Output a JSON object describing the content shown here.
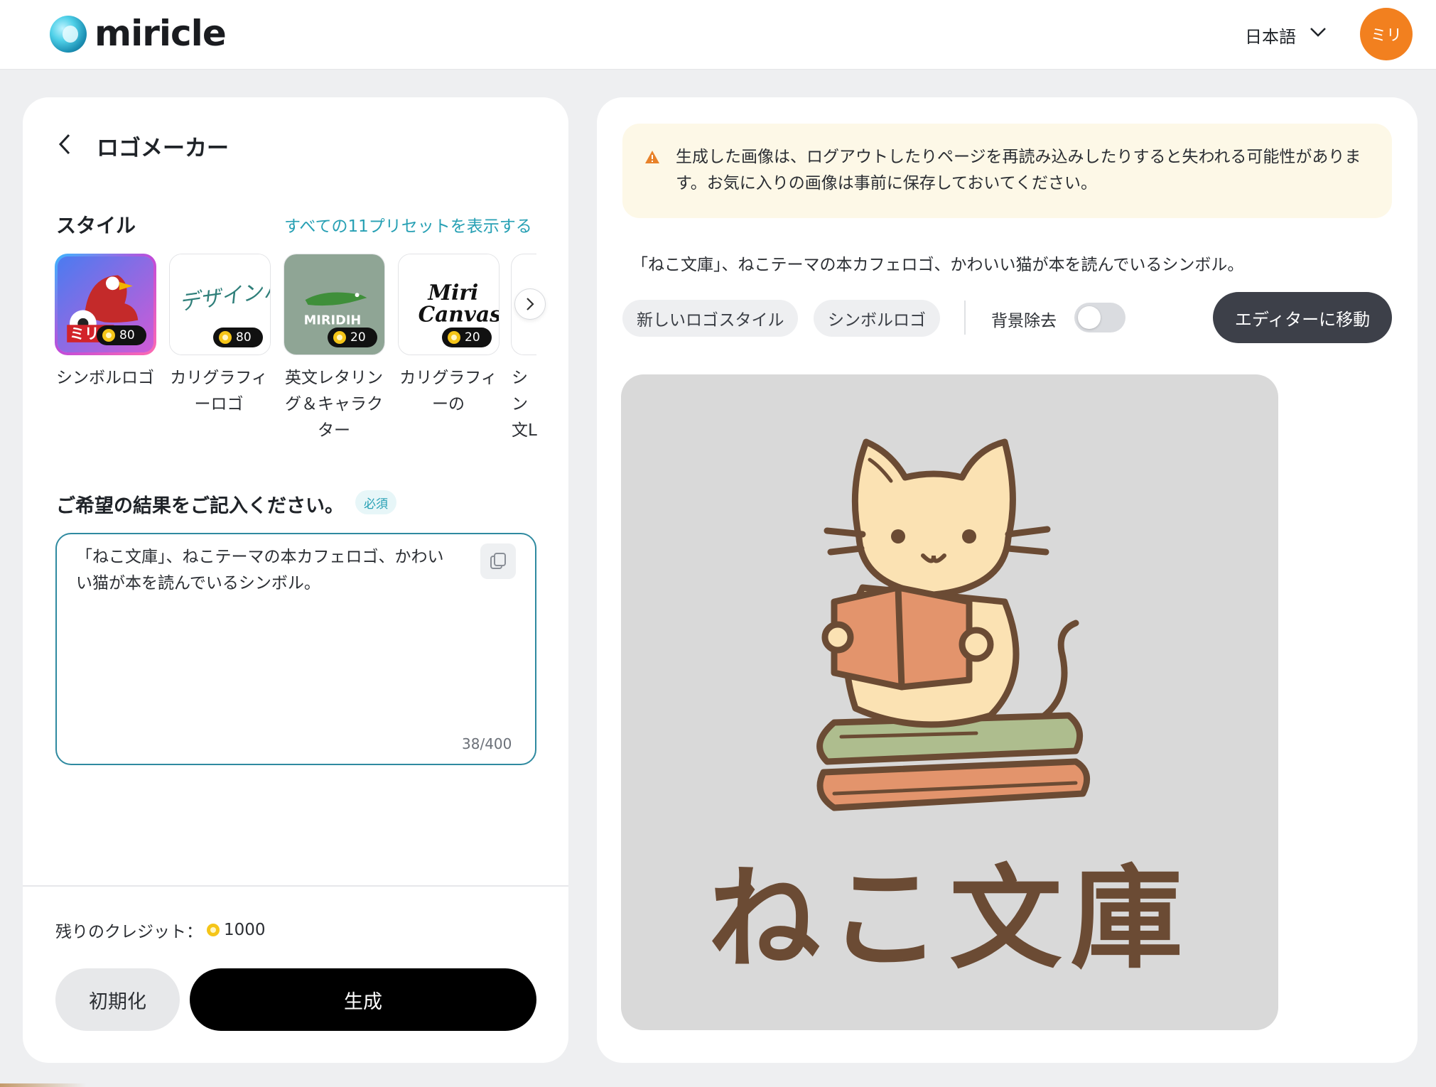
{
  "header": {
    "brand": "miricle",
    "language": "日本語",
    "avatar_initials": "ミリ"
  },
  "left_panel": {
    "title": "ロゴメーカー",
    "style_label": "スタイル",
    "presets_link": "すべての11プリセットを表示する",
    "presets": [
      {
        "label": "シンボルロゴ",
        "credits": "80",
        "selected": true
      },
      {
        "label": "カリグラフィーロゴ",
        "credits": "80",
        "selected": false
      },
      {
        "label": "英文レタリング＆キャラクター",
        "credits": "20",
        "selected": false
      },
      {
        "label": "カリグラフィーの",
        "credits": "20",
        "selected": false
      },
      {
        "label": "シン文L",
        "selected": false
      }
    ],
    "preset_art_text": {
      "p1": "ミリエ",
      "p2": "デザインハブ",
      "p3": "MIRIDIH",
      "p4_line1": "Miri",
      "p4_line2": "Canvas"
    },
    "prompt_label": "ご希望の結果をご記入ください。",
    "required_badge": "必須",
    "prompt_value": "「ねこ文庫」、ねこテーマの本カフェロゴ、かわいい猫が本を読んでいるシンボル。",
    "char_count": "38/400",
    "credits_label": "残りのクレジット：",
    "credits_value": "1000",
    "reset_button": "初期化",
    "generate_button": "生成"
  },
  "right_panel": {
    "notice": "生成した画像は、ログアウトしたりページを再読み込みしたりすると失われる可能性があります。お気に入りの画像は事前に保存しておいてください。",
    "prompt_display": "「ねこ文庫」、ねこテーマの本カフェロゴ、かわいい猫が本を読んでいるシンボル。",
    "chips": [
      "新しいロゴスタイル",
      "シンボルロゴ"
    ],
    "bg_removal_label": "背景除去",
    "bg_removal_on": false,
    "editor_button": "エディターに移動",
    "result_logo_text": "ねこ文庫"
  },
  "colors": {
    "accent": "#27a0b4",
    "avatar": "#f2801f",
    "generate": "#000000",
    "editor": "#3d4049",
    "notice_bg": "#fdf8e7",
    "warning": "#e8822a",
    "logo_brown": "#6b4b34"
  },
  "icons": {
    "brand": "miricle-orb-icon",
    "language_caret": "chevron-down-icon",
    "back": "chevron-left-icon",
    "carousel_next": "chevron-right-icon",
    "copy": "copy-icon",
    "warning": "warning-triangle-icon",
    "credit": "coin-icon"
  }
}
